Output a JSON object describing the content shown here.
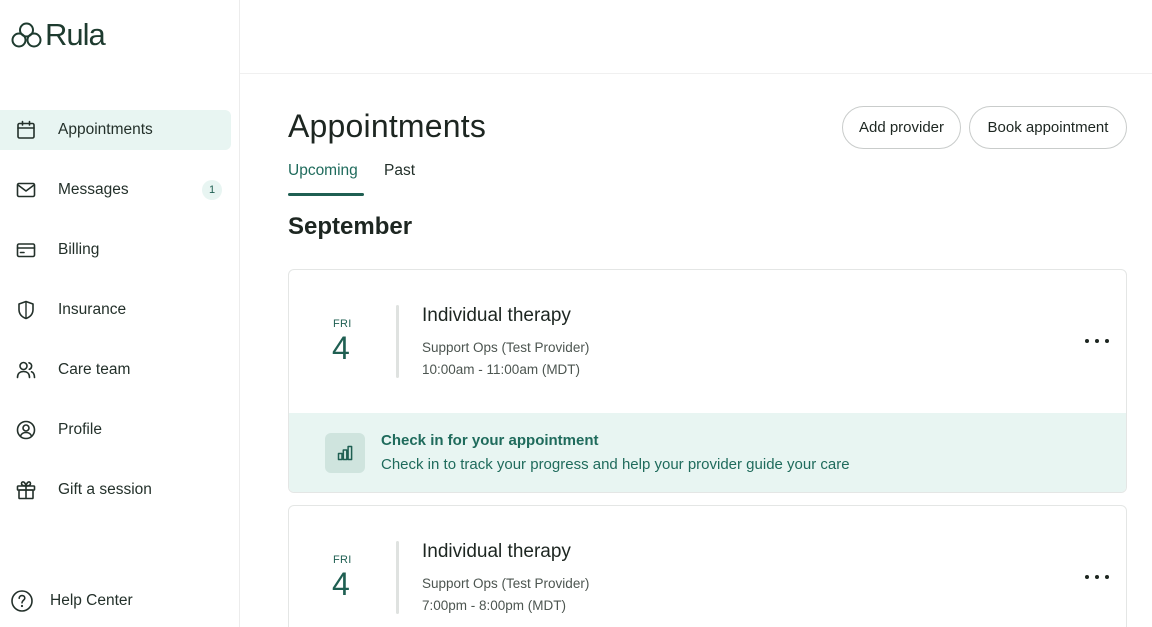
{
  "brand": {
    "name": "Rula",
    "accent": "#1f5f52",
    "accent_light": "#e8f5f2"
  },
  "sidebar": {
    "items": [
      {
        "label": "Appointments",
        "icon": "calendar-icon",
        "active": true
      },
      {
        "label": "Messages",
        "icon": "mail-icon",
        "badge": "1"
      },
      {
        "label": "Billing",
        "icon": "credit-card-icon"
      },
      {
        "label": "Insurance",
        "icon": "shield-icon"
      },
      {
        "label": "Care team",
        "icon": "people-icon"
      },
      {
        "label": "Profile",
        "icon": "user-circle-icon"
      },
      {
        "label": "Gift a session",
        "icon": "gift-icon"
      }
    ],
    "help": {
      "label": "Help Center",
      "icon": "help-circle-icon"
    }
  },
  "main": {
    "title": "Appointments",
    "buttons": {
      "add_provider": "Add provider",
      "book_appointment": "Book appointment"
    },
    "tabs": [
      {
        "label": "Upcoming",
        "active": true
      },
      {
        "label": "Past"
      }
    ],
    "month": "September",
    "appointments": [
      {
        "day": "FRI",
        "date": "4",
        "title": "Individual therapy",
        "provider": "Support Ops (Test Provider)",
        "time": "10:00am - 11:00am (MDT)",
        "checkin": {
          "title": "Check in for your appointment",
          "subtitle": "Check in to track your progress and help your provider guide your care",
          "icon": "bar-chart-icon"
        }
      },
      {
        "day": "FRI",
        "date": "4",
        "title": "Individual therapy",
        "provider": "Support Ops (Test Provider)",
        "time": "7:00pm - 8:00pm (MDT)"
      }
    ]
  }
}
